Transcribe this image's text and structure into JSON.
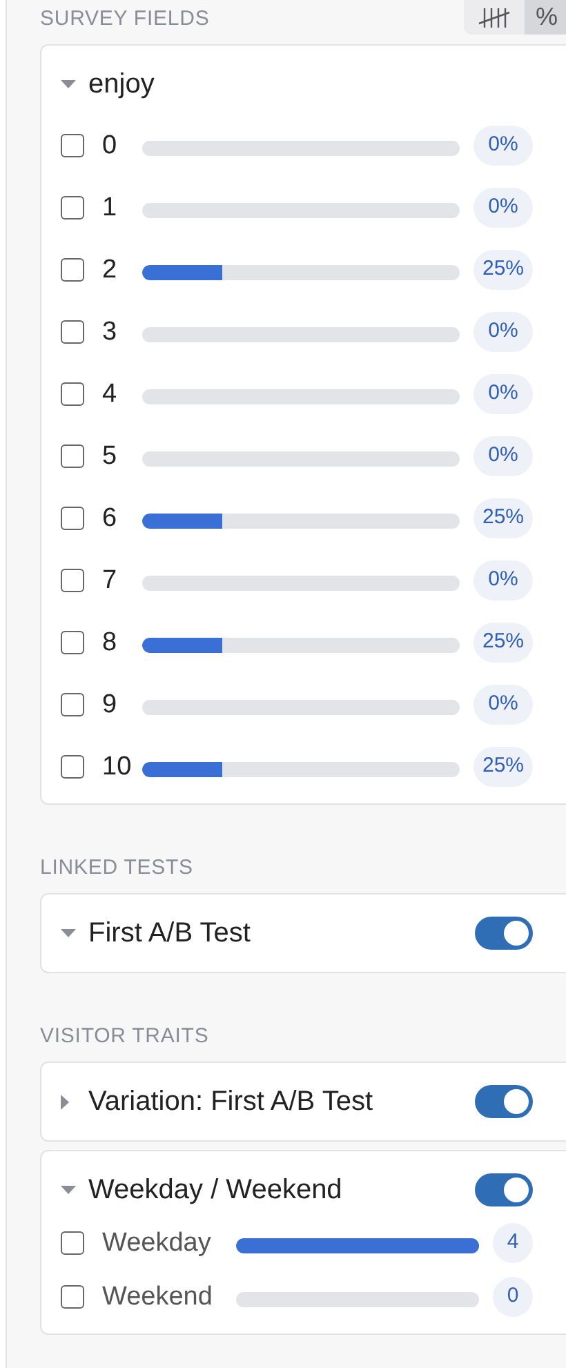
{
  "view_modes": [
    {
      "kind": "tally",
      "selected": false
    },
    {
      "kind": "percent",
      "label": "%",
      "selected": true
    }
  ],
  "survey_fields": {
    "heading": "SURVEY FIELDS",
    "groups": [
      {
        "title": "enjoy",
        "expanded": true,
        "options": [
          {
            "label": "0",
            "checked": false,
            "level": 0,
            "value": "0%"
          },
          {
            "label": "1",
            "checked": false,
            "level": 0,
            "value": "0%"
          },
          {
            "label": "2",
            "checked": false,
            "level": 0.25,
            "value": "25%"
          },
          {
            "label": "3",
            "checked": false,
            "level": 0,
            "value": "0%"
          },
          {
            "label": "4",
            "checked": false,
            "level": 0,
            "value": "0%"
          },
          {
            "label": "5",
            "checked": false,
            "level": 0,
            "value": "0%"
          },
          {
            "label": "6",
            "checked": false,
            "level": 0.25,
            "value": "25%"
          },
          {
            "label": "7",
            "checked": false,
            "level": 0,
            "value": "0%"
          },
          {
            "label": "8",
            "checked": false,
            "level": 0.25,
            "value": "25%"
          },
          {
            "label": "9",
            "checked": false,
            "level": 0,
            "value": "0%"
          },
          {
            "label": "10",
            "checked": false,
            "level": 0.25,
            "value": "25%"
          }
        ]
      }
    ]
  },
  "linked_tests": {
    "heading": "LINKED TESTS",
    "groups": [
      {
        "title": "First A/B Test",
        "expanded": true,
        "on": true
      }
    ]
  },
  "visitor_traits": {
    "heading": "VISITOR TRAITS",
    "groups": [
      {
        "title": "Variation: First A/B Test",
        "expanded": false,
        "on": true
      },
      {
        "title": "Weekday / Weekend",
        "expanded": true,
        "on": true,
        "options": [
          {
            "label": "Weekday",
            "checked": false,
            "level": 1,
            "value": "4"
          },
          {
            "label": "Weekend",
            "checked": false,
            "level": 0,
            "value": "0"
          }
        ]
      }
    ]
  }
}
